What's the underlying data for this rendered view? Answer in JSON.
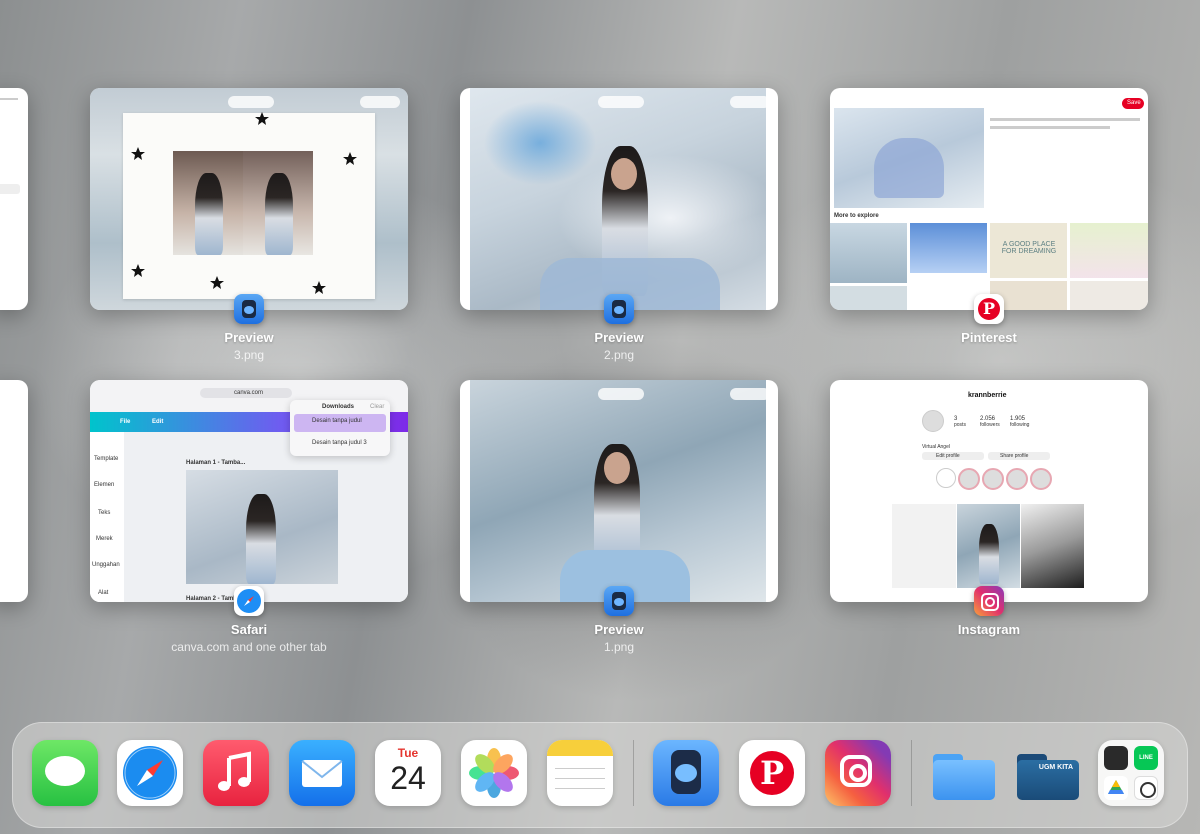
{
  "switcher": {
    "cards": [
      {
        "id": "preview-3",
        "app": "Preview",
        "subtitle": "3.png"
      },
      {
        "id": "preview-2",
        "app": "Preview",
        "subtitle": "2.png"
      },
      {
        "id": "pinterest",
        "app": "Pinterest",
        "subtitle": ""
      },
      {
        "id": "safari",
        "app": "Safari",
        "subtitle": "canva.com and one other tab"
      },
      {
        "id": "preview-1",
        "app": "Preview",
        "subtitle": "1.png"
      },
      {
        "id": "instagram",
        "app": "Instagram",
        "subtitle": ""
      }
    ],
    "thumb_text": {
      "pinterest_save": "Save",
      "pinterest_more": "More to explore",
      "pinterest_caption": "A GOOD PLACE FOR DREAMING",
      "safari_url": "canva.com",
      "safari_downloads": "Downloads",
      "safari_clear": "Clear",
      "safari_file1": "Desain tanpa judul",
      "safari_file2": "Desain tanpa judul 3",
      "canva_menu_file": "File",
      "canva_menu_edit": "Edit",
      "canva_page1": "Halaman 1 - Tamba...",
      "canva_page2": "Halaman 2 - Tamb",
      "canva_side": [
        "Template",
        "Elemen",
        "Teks",
        "Merek",
        "Unggahan",
        "Alat"
      ],
      "ig_username": "krannberrie",
      "ig_stats": [
        {
          "n": "3",
          "l": "posts"
        },
        {
          "n": "2.056",
          "l": "followers"
        },
        {
          "n": "1.905",
          "l": "following"
        }
      ],
      "ig_edit": "Edit profile",
      "ig_share": "Share profile",
      "ig_virtual": "Virtual Angel"
    }
  },
  "dock": {
    "apps": [
      {
        "name": "Messages"
      },
      {
        "name": "Safari"
      },
      {
        "name": "Music"
      },
      {
        "name": "Mail"
      },
      {
        "name": "Calendar",
        "weekday": "Tue",
        "day": "24"
      },
      {
        "name": "Photos"
      },
      {
        "name": "Notes"
      },
      {
        "name": "Preview"
      },
      {
        "name": "Pinterest"
      },
      {
        "name": "Instagram"
      },
      {
        "name": "Files"
      },
      {
        "name": "UGM KITA",
        "label": "UGM KITA"
      },
      {
        "name": "App folder",
        "line": "LINE"
      }
    ]
  },
  "colors": {
    "pinterest": "#e60023",
    "canva_purple": "#7d2ae8",
    "canva_teal": "#00c4cc"
  }
}
